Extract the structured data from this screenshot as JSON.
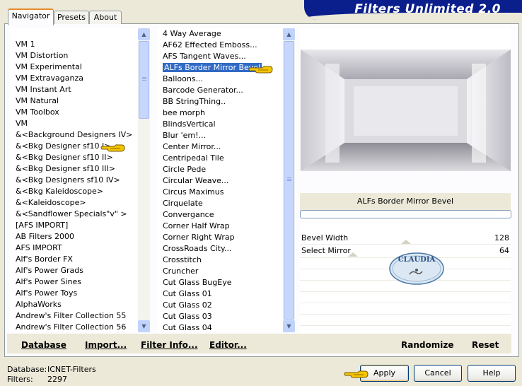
{
  "banner": {
    "title": "Filters Unlimited 2.0"
  },
  "tabs": [
    {
      "label": "Navigator",
      "active": true
    },
    {
      "label": "Presets",
      "active": false
    },
    {
      "label": "About",
      "active": false
    }
  ],
  "categories": {
    "items": [
      "VM 1",
      "VM Distortion",
      "VM Experimental",
      "VM Extravaganza",
      "VM Instant Art",
      "VM Natural",
      "VM Toolbox",
      "VM",
      "&<Background Designers IV>",
      "&<Bkg Designer sf10 I>",
      "&<Bkg Designer sf10 II>",
      "&<Bkg Designer sf10 III>",
      "&<Bkg Designers sf10 IV>",
      "&<Bkg Kaleidoscope>",
      "&<Kaleidoscope>",
      "&<Sandflower Specials\"v\" >",
      "[AFS IMPORT]",
      "AB Filters 2000",
      "AFS IMPORT",
      "Alf's Border FX",
      "Alf's Power Grads",
      "Alf's Power Sines",
      "Alf's Power Toys",
      "AlphaWorks",
      "Andrew's Filter Collection 55",
      "Andrew's Filter Collection 56"
    ],
    "pointed_index": 9
  },
  "filters": {
    "items": [
      "4 Way Average",
      "AF62 Effected Emboss...",
      "AFS Tangent Waves...",
      "ALFs Border Mirror Bevel",
      "Balloons...",
      "Barcode Generator...",
      "BB StringThing..",
      "bee morph",
      "BlindsVertical",
      "Blur 'em!...",
      "Center Mirror...",
      "Centripedal Tile",
      "Circle Pede",
      "Circular Weave...",
      "Circus Maximus",
      "Cirquelate",
      "Convergance",
      "Corner Half Wrap",
      "Corner Right Wrap",
      "CrossRoads City...",
      "Crosstitch",
      "Cruncher",
      "Cut Glass  BugEye",
      "Cut Glass 01",
      "Cut Glass 02",
      "Cut Glass 03",
      "Cut Glass 04"
    ],
    "selected_index": 3
  },
  "preview": {
    "filter_name": "ALFs Border Mirror Bevel",
    "watermark": "CLAUDIA"
  },
  "params": [
    {
      "label": "Bevel Width",
      "value": "128",
      "level": 0.502
    },
    {
      "label": "Select Mirror",
      "value": "64",
      "level": 0.251
    }
  ],
  "bottom_links": [
    "Database",
    "Import...",
    "Filter Info...",
    "Editor...",
    "Randomize",
    "Reset"
  ],
  "status": {
    "database_label": "Database:",
    "database_value": "ICNET-Filters",
    "filters_label": "Filters:",
    "filters_value": "2297"
  },
  "buttons": {
    "apply": "Apply",
    "cancel": "Cancel",
    "help": "Help"
  },
  "colors": {
    "banner": "#0a1e8c",
    "selection": "#316ac5",
    "pointer_hand": "#f5c400"
  }
}
